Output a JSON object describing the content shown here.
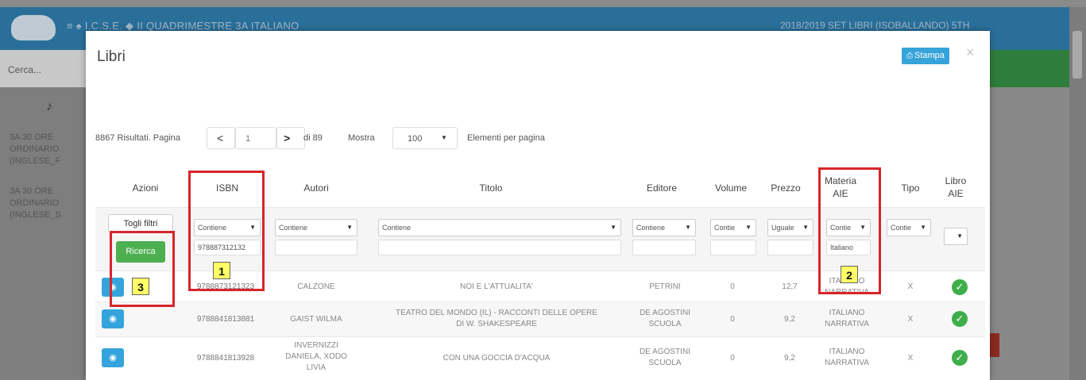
{
  "background": {
    "crumbs": "≡ ♠ I.C.S.E. ◆ II QUADRIMESTRE  3A ITALIANO",
    "user": "2018/2019  SET LIBRI (ISOBALLANDO) 5TH",
    "search": "Cerca...",
    "side_items": [
      "3A 30 ORE\nORDINARIO\n(INGLESE_F",
      "3A 30 ORE\nORDINARIO\n(INGLESE_S"
    ]
  },
  "modal": {
    "title": "Libri",
    "print_label": "Stampa",
    "close": "×"
  },
  "pager": {
    "results": "8867 Risultati. Pagina",
    "page": "1",
    "of_pages": "di 89",
    "show_label": "Mostra",
    "per_page": "100",
    "per_page_suffix": "Elementi per pagina"
  },
  "columns": {
    "azioni": "Azioni",
    "isbn": "ISBN",
    "autori": "Autori",
    "titolo": "Titolo",
    "editore": "Editore",
    "volume": "Volume",
    "prezzo": "Prezzo",
    "materia": "Materia\nAIE",
    "tipo": "Tipo",
    "libro": "Libro\nAIE"
  },
  "filters": {
    "togli_label": "Togli filtri",
    "ricerca_label": "Ricerca",
    "isbn_op": "Contiene",
    "isbn_value": "978887312132",
    "autori_op": "Contiene",
    "titolo_op": "Contiene",
    "editore_op": "Contiene",
    "volume_op": "Contie",
    "prezzo_op": "Uguale",
    "materia_op": "Contie",
    "materia_value": "Italiano",
    "tipo_op": "Contie",
    "libro_op": ""
  },
  "rows": [
    {
      "isbn": "9788873121323",
      "autori": "CALZONE",
      "titolo": "NOI E L'ATTUALITA'",
      "editore": "PETRINI",
      "volume": "0",
      "prezzo": "12,7",
      "materia": "ITALIANO\nNARRATIVA",
      "tipo": "X"
    },
    {
      "isbn": "9788841813881",
      "autori": "GAIST WILMA",
      "titolo": "TEATRO DEL MONDO (IL) - RACCONTI DELLE OPERE\nDI W. SHAKESPEARE",
      "editore": "DE AGOSTINI\nSCUOLA",
      "volume": "0",
      "prezzo": "9,2",
      "materia": "ITALIANO\nNARRATIVA",
      "tipo": "X"
    },
    {
      "isbn": "9788841813928",
      "autori": "INVERNIZZI\nDANIELA, XODO\nLIVIA",
      "titolo": "CON UNA GOCCIA D'ACQUA",
      "editore": "DE AGOSTINI\nSCUOLA",
      "volume": "0",
      "prezzo": "9,2",
      "materia": "ITALIANO\nNARRATIVA",
      "tipo": "X"
    }
  ],
  "annotations": [
    "1",
    "2",
    "3"
  ],
  "colors": {
    "accent_blue": "#35a4dc",
    "green": "#4caf50",
    "annotation_red": "#d8242a",
    "annotation_yellow": "#ffff66"
  }
}
